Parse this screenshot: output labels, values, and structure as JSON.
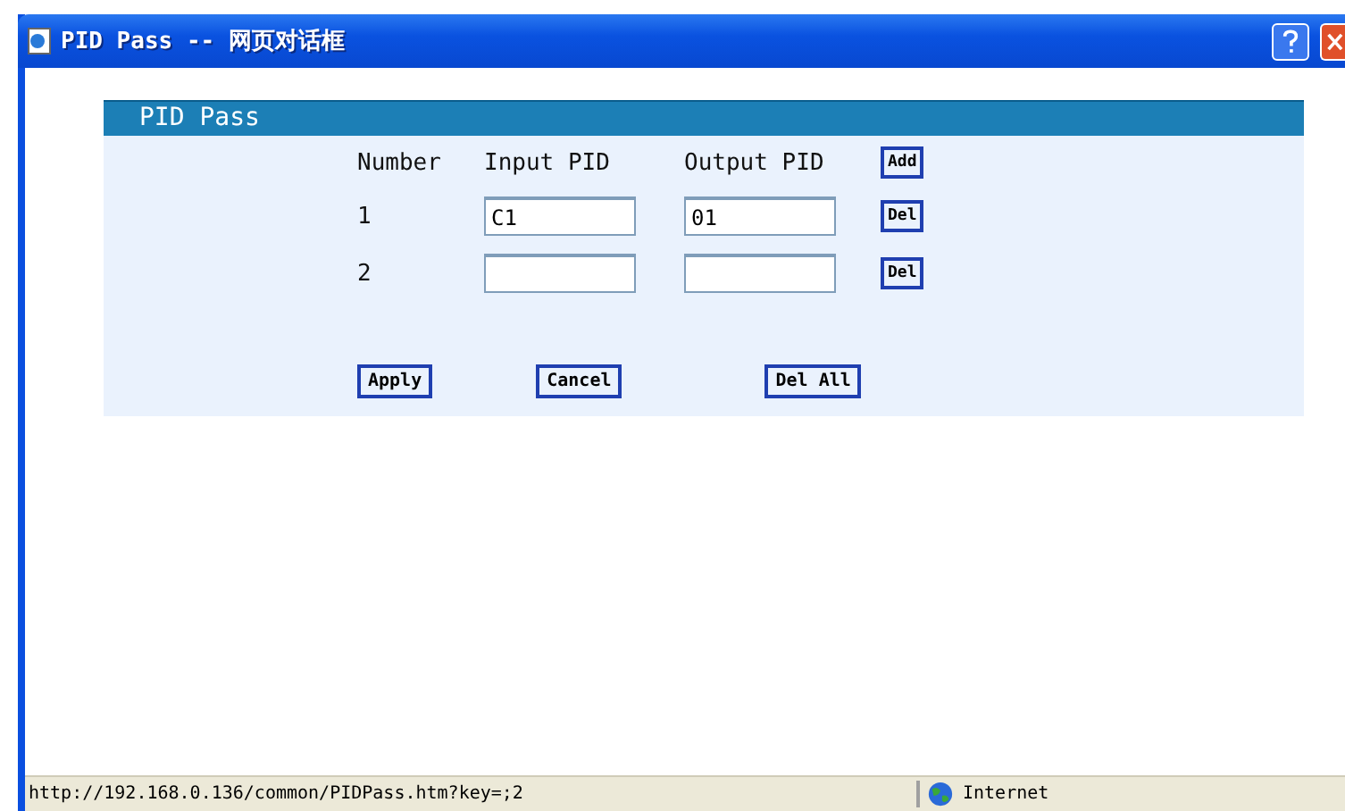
{
  "window": {
    "title": "PID Pass -- 网页对话框"
  },
  "panel": {
    "title": "PID Pass",
    "columns": [
      "Number",
      "Input PID",
      "Output PID"
    ],
    "add_button": "Add",
    "rows": [
      {
        "number": "1",
        "input_pid": "C1",
        "output_pid": "01",
        "button": "Del"
      },
      {
        "number": "2",
        "input_pid": "",
        "output_pid": "",
        "button": "Del"
      }
    ],
    "buttons": [
      "Apply",
      "Cancel",
      "Del All"
    ]
  },
  "status_bar": {
    "url": "http://192.168.0.136/common/PIDPass.htm?key=;2",
    "zone": "Internet"
  }
}
